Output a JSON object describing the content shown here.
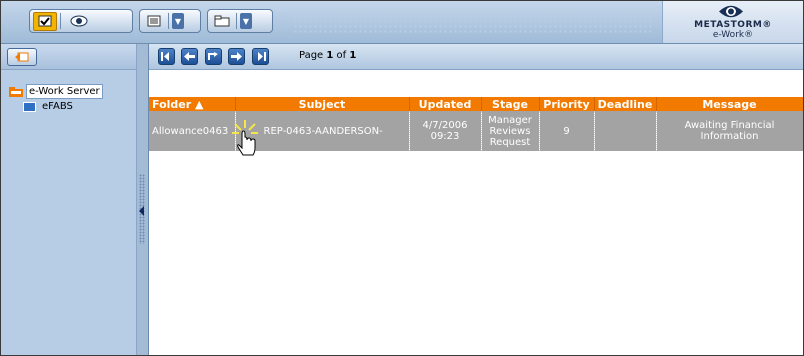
{
  "toolbar": {
    "groups": [
      {
        "icons": [
          "checkbox-icon",
          "eye-icon"
        ]
      },
      {
        "icons": [
          "list-icon"
        ]
      },
      {
        "icons": [
          "folder-icon"
        ]
      }
    ]
  },
  "logo": {
    "line1": "METASTORM®",
    "line2": "e-Work®"
  },
  "tree": {
    "root": "e-Work Server",
    "child": "eFABS"
  },
  "pagination": {
    "prefix": "Page ",
    "current": "1",
    "of": " of ",
    "total": "1"
  },
  "grid": {
    "columns": [
      "Folder ▲",
      "Subject",
      "Updated",
      "Stage",
      "Priority",
      "Deadline",
      "Message"
    ],
    "rows": [
      {
        "folder": "Allowance0463",
        "subject": "REP-0463-AANDERSON-",
        "updated_date": "4/7/2006",
        "updated_time": "09:23",
        "stage_1": "Manager",
        "stage_2": "Reviews",
        "stage_3": "Request",
        "priority": "9",
        "deadline": "",
        "message_1": "Awaiting Financial",
        "message_2": "Information"
      }
    ]
  },
  "colors": {
    "header_orange": "#f27a00",
    "row_gray": "#a3a3a3",
    "panel_blue": "#b7cde6"
  }
}
